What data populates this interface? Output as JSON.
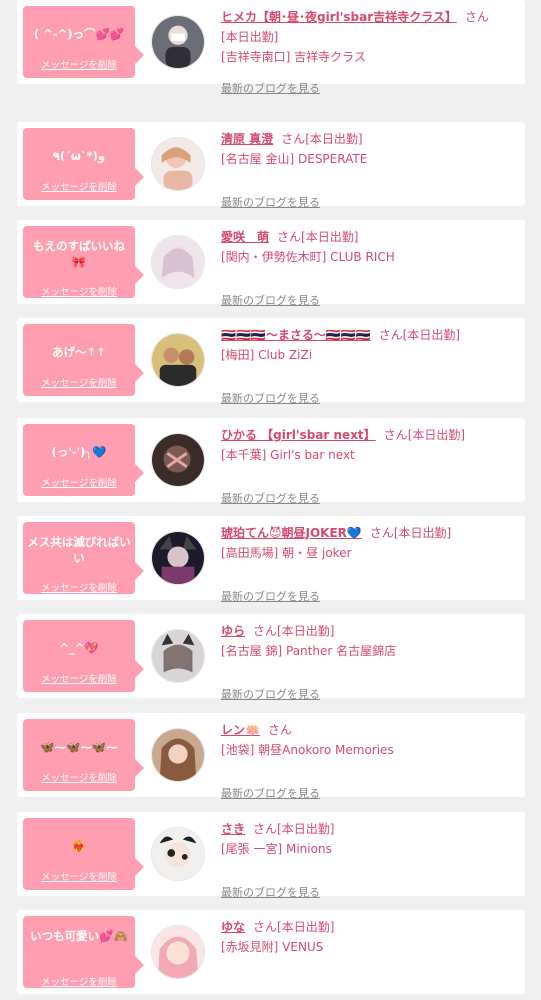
{
  "colors": {
    "page_bg": "#f0f0f0",
    "bubble_bg": "#ff9eb0",
    "accent": "#d6496d",
    "link_gray": "#888888"
  },
  "delete_label": "メッセージを削除",
  "blog_label": "最新のブログを見る",
  "honorific": "さん",
  "items": [
    {
      "message": "( ^-^)っ⌒💕💕",
      "name": "ヒメカ【朝･昼･夜girl'sbar吉祥寺クラス】",
      "status": "",
      "location": "[本日出勤]",
      "shop": "[吉祥寺南口] 吉祥寺クラス"
    },
    {
      "message": "٩(ˊωˋ*)و",
      "name": "清原 真澄",
      "status": "[本日出勤]",
      "location": "",
      "shop": "[名古屋 金山] DESPERATE"
    },
    {
      "message": "もえのすばいいね🎀",
      "name": "愛咲　萌",
      "status": "[本日出勤]",
      "location": "",
      "shop": "[関内・伊勢佐木町] CLUB RICH"
    },
    {
      "message": "あげ〜↑↑",
      "name": "🇹🇭🇹🇭🇹🇭〜まさる〜🇹🇭🇹🇭🇹🇭",
      "status": "[本日出勤]",
      "location": "",
      "shop": "[梅田] Club ZiZi"
    },
    {
      "message": "(っ'-')╮💙",
      "name": "ひかる 【girl'sbar next】",
      "status": "[本日出勤]",
      "location": "",
      "shop": "[本千葉] Girl's bar next"
    },
    {
      "message": "メス共は滅びればいい",
      "name": "琥珀てん😈朝昼JOKER💙",
      "status": "[本日出勤]",
      "location": "",
      "shop": "[高田馬場] 朝・昼 joker"
    },
    {
      "message": "^_^💖",
      "name": "ゆら",
      "status": "[本日出勤]",
      "location": "",
      "shop": "[名古屋 錦] Panther 名古屋錦店"
    },
    {
      "message": "🦋⁓🦋⁓🦋⁓",
      "name": "レン🪷",
      "status": "",
      "location": "",
      "shop": "[池袋] 朝昼Anokoro Memories"
    },
    {
      "message": "❤️‍🔥",
      "name": "さき",
      "status": "[本日出勤]",
      "location": "",
      "shop": "[尾張 一宮] Minions"
    },
    {
      "message": "いつも可愛い💕🙈",
      "name": "ゆな",
      "status": "[本日出勤]",
      "location": "",
      "shop": "[赤坂見附] VENUS"
    }
  ]
}
